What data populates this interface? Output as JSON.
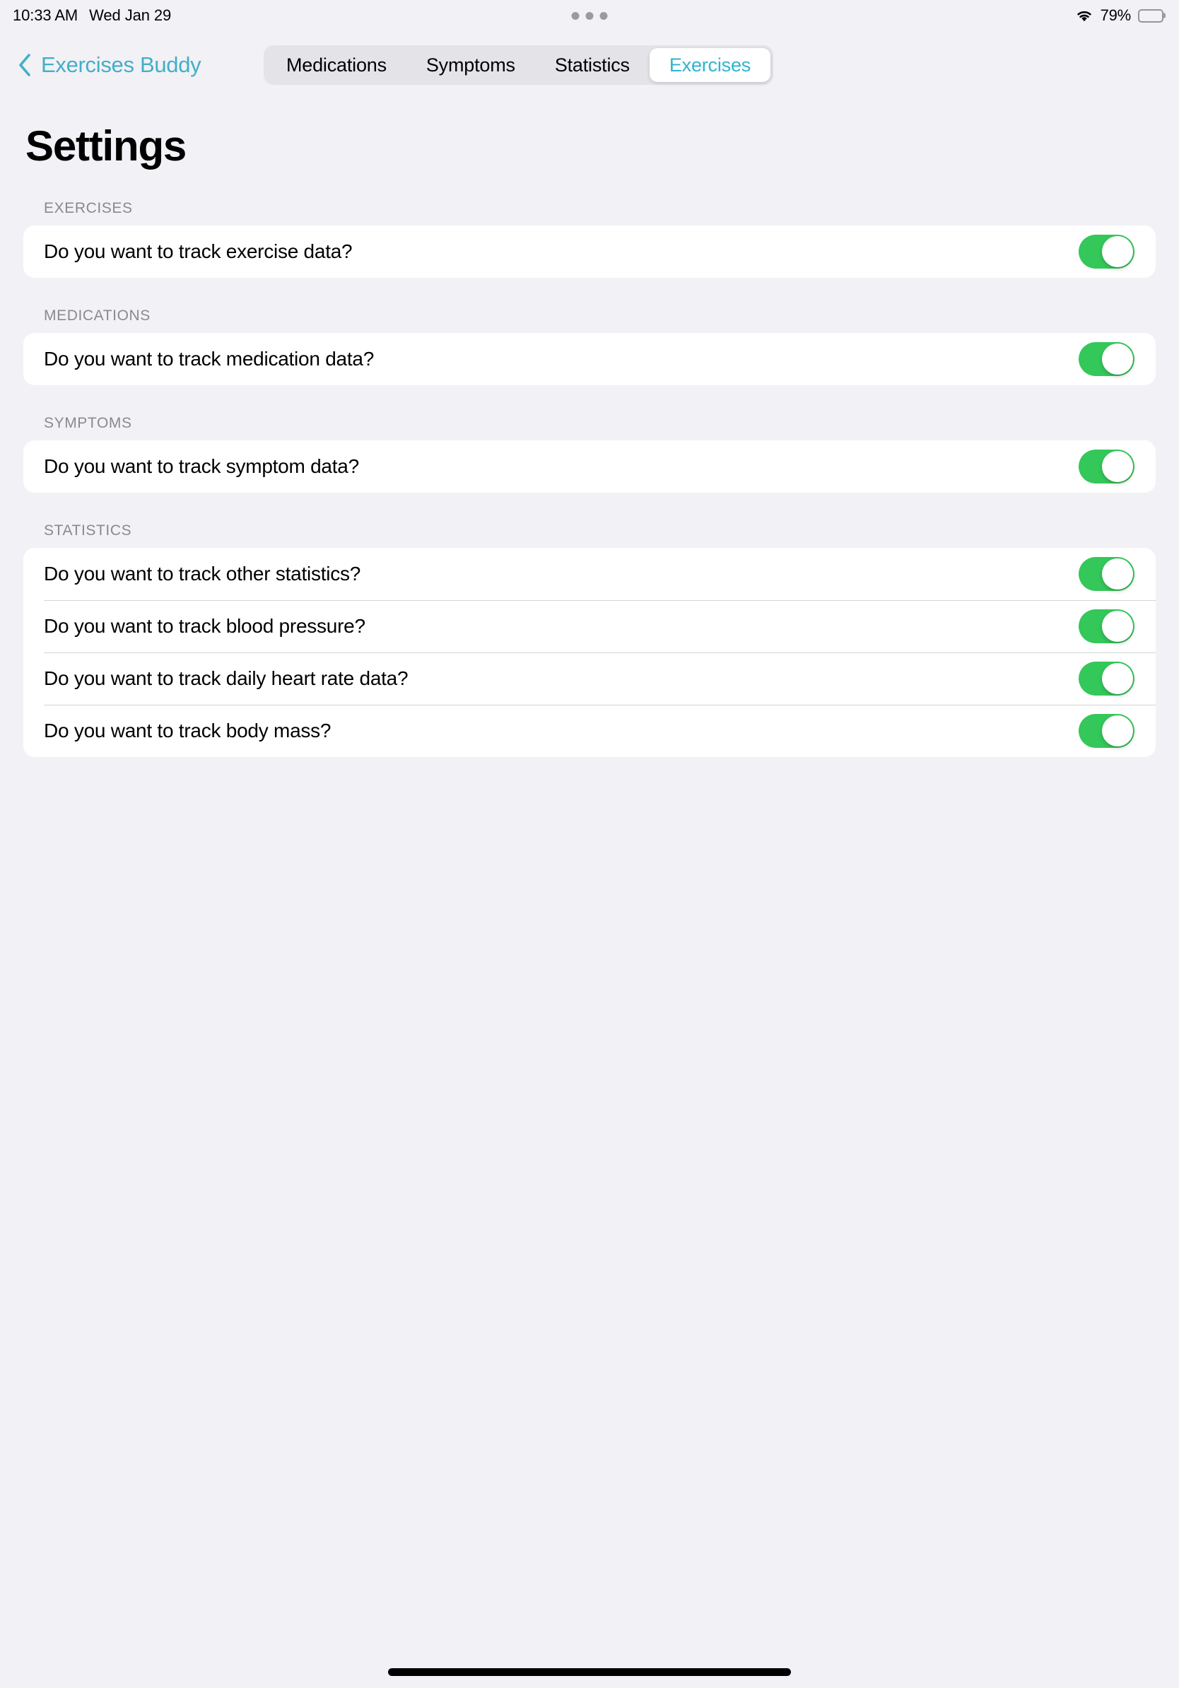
{
  "status_bar": {
    "time": "10:33 AM",
    "date": "Wed Jan 29",
    "wifi_icon": "wifi-icon",
    "battery_percent": "79%",
    "battery_level": 79,
    "multitask_dots": 3
  },
  "nav": {
    "back_icon": "chevron-left-icon",
    "back_label": "Exercises Buddy",
    "segmented_control": {
      "selected": "Exercises",
      "items": [
        {
          "label": "Medications",
          "selected": false
        },
        {
          "label": "Symptoms",
          "selected": false
        },
        {
          "label": "Statistics",
          "selected": false
        },
        {
          "label": "Exercises",
          "selected": true
        }
      ]
    }
  },
  "page": {
    "title": "Settings"
  },
  "sections": [
    {
      "header": "EXERCISES",
      "rows": [
        {
          "label": "Do you want to track exercise data?",
          "toggle": true
        }
      ]
    },
    {
      "header": "MEDICATIONS",
      "rows": [
        {
          "label": "Do you want to track medication data?",
          "toggle": true
        }
      ]
    },
    {
      "header": "SYMPTOMS",
      "rows": [
        {
          "label": "Do you want to track symptom data?",
          "toggle": true
        }
      ]
    },
    {
      "header": "STATISTICS",
      "rows": [
        {
          "label": "Do you want to track other statistics?",
          "toggle": true
        },
        {
          "label": "Do you want to track blood pressure?",
          "toggle": true
        },
        {
          "label": "Do you want to track daily heart rate data?",
          "toggle": true
        },
        {
          "label": "Do you want to track body mass?",
          "toggle": true
        }
      ]
    }
  ],
  "colors": {
    "accent_teal": "#41B0C6",
    "toggle_on_green": "#34C759",
    "page_background": "#F2F1F6",
    "card_background": "#FFFFFF",
    "section_header_gray": "#8A8A8E",
    "segmented_track": "#E4E3E8"
  }
}
